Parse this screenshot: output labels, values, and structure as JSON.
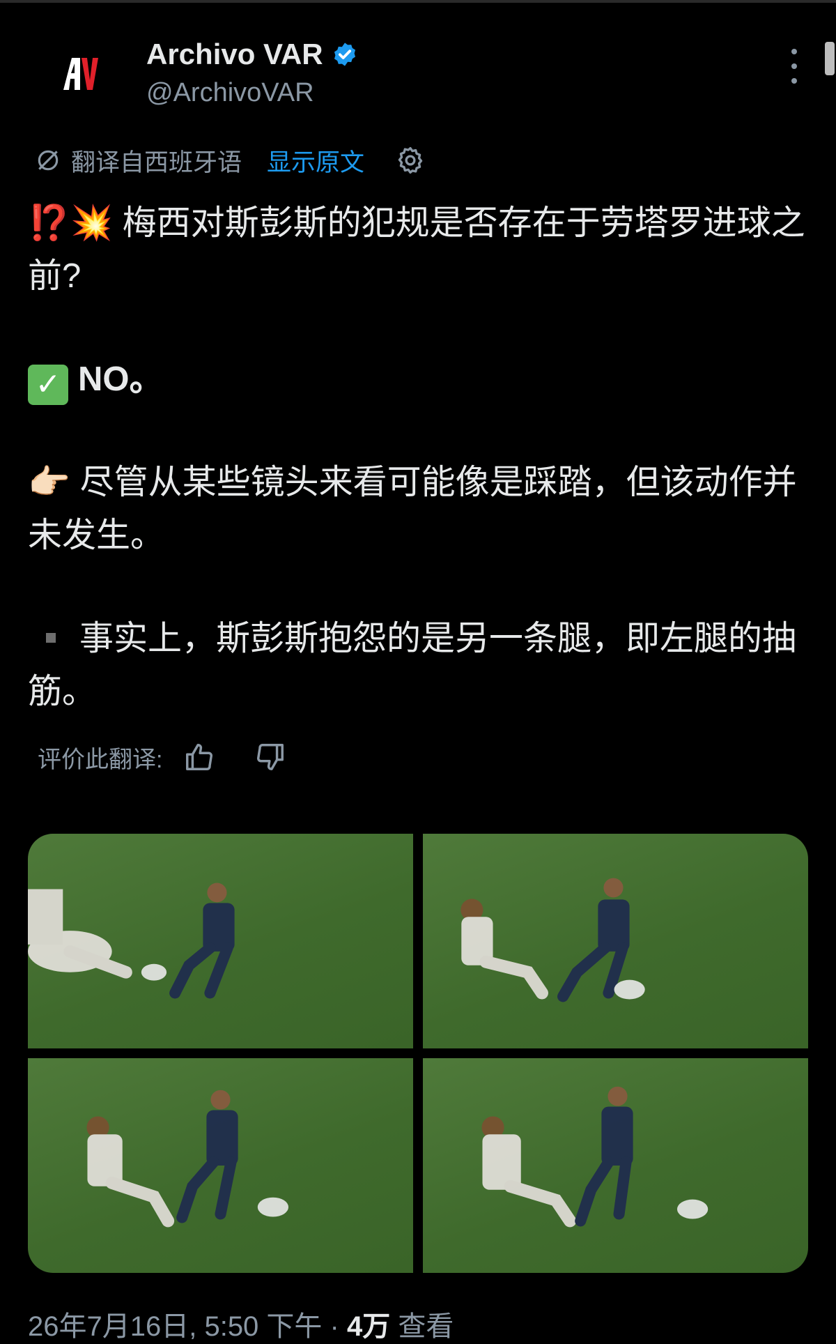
{
  "header": {
    "display_name": "Archivo VAR",
    "handle": "@ArchivoVAR",
    "avatar_text": "AV"
  },
  "translation": {
    "label": "翻译自西班牙语",
    "show_original": "显示原文"
  },
  "tweet": {
    "line1_emoji": "⁉️💥",
    "line1": "梅西对斯彭斯的犯规是否存在于劳塔罗进球之前?",
    "line2": "NO。",
    "line3_emoji": "👉🏻",
    "line3": "尽管从某些镜头来看可能像是踩踏，但该动作并未发生。",
    "line4": "事实上，斯彭斯抱怨的是另一条腿，即左腿的抽筋。"
  },
  "rating": {
    "label": "评价此翻译:"
  },
  "media": {
    "frames": [
      "frame-1",
      "frame-2",
      "frame-3",
      "frame-4"
    ]
  },
  "meta": {
    "date": "26年7月16日, 5:50 下午 · ",
    "views_count": "4万",
    "views_label": " 查看"
  },
  "icons": {
    "verified": "verified-badge-icon",
    "more": "more-vertical-icon",
    "translate": "translate-icon",
    "settings": "gear-icon",
    "like": "thumbs-up-icon",
    "dislike": "thumbs-down-icon"
  },
  "colors": {
    "background": "#000000",
    "text": "#e7e9ea",
    "secondary": "#8b98a5",
    "link": "#1d9bf0",
    "verified": "#1d9bf0",
    "pitch": "#4a7436"
  }
}
